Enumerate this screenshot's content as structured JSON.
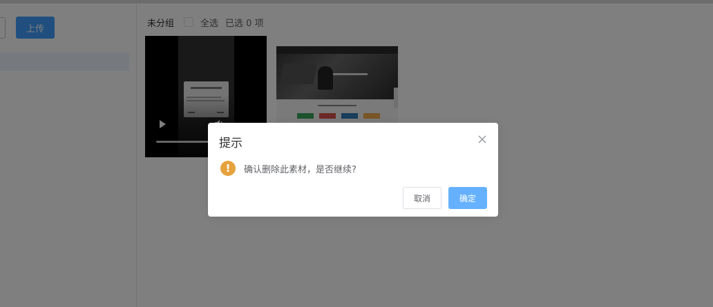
{
  "sidebar": {
    "upload_label": "上传"
  },
  "toolbar": {
    "group_name": "未分组",
    "select_all_label": "全选",
    "selected_count": "已选 0 项"
  },
  "dialog": {
    "title": "提示",
    "message": "确认删除此素材，是否继续?",
    "cancel_label": "取消",
    "confirm_label": "确定",
    "warning_icon_glyph": "!",
    "warning_color": "#e6a23c",
    "confirm_color": "#66b1ff"
  },
  "materials": [
    {
      "type": "video",
      "thumbnail": "phone-screen"
    },
    {
      "type": "video",
      "thumbnail": "website-screen"
    }
  ],
  "colors": {
    "primary": "#409eff",
    "overlay": "rgba(0,0,0,0.5)"
  }
}
